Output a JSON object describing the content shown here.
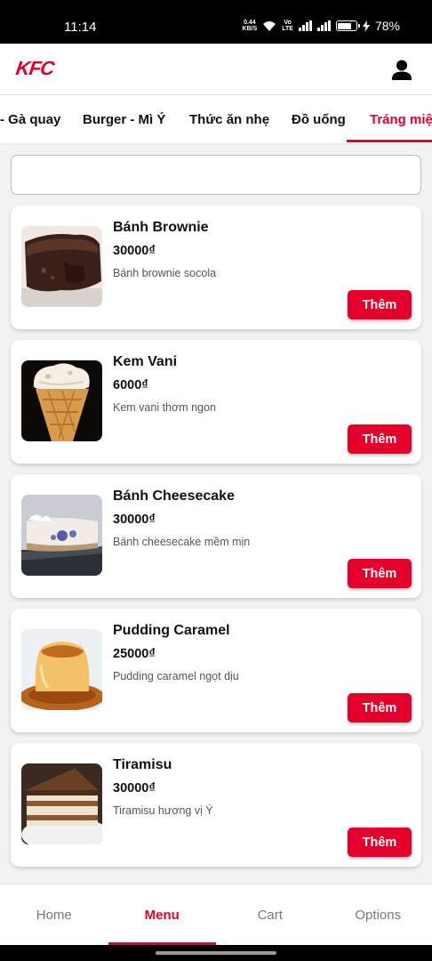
{
  "status_bar": {
    "time": "11:14",
    "net_speed_value": "0.44",
    "net_speed_unit": "KB/S",
    "volte_top": "Vo",
    "volte_bottom": "LTE",
    "battery": "78%"
  },
  "header": {
    "logo": "KFC",
    "brand_color": "#e4002b"
  },
  "tabs": [
    {
      "label": "- Gà quay",
      "active": false
    },
    {
      "label": "Burger - Mì Ý",
      "active": false
    },
    {
      "label": "Thức ăn nhẹ",
      "active": false
    },
    {
      "label": "Đồ uống",
      "active": false
    },
    {
      "label": "Tráng miệng",
      "active": true
    }
  ],
  "search": {
    "value": "",
    "placeholder": ""
  },
  "products": [
    {
      "name": "Bánh Brownie",
      "price": "30000₫",
      "description": "Bánh brownie socola",
      "button": "Thêm",
      "image": "brownie-image"
    },
    {
      "name": "Kem Vani",
      "price": "6000₫",
      "description": "Kem vani thơm ngon",
      "button": "Thêm",
      "image": "ice-cream-image"
    },
    {
      "name": "Bánh Cheesecake",
      "price": "30000₫",
      "description": "Bánh cheesecake mềm mịn",
      "button": "Thêm",
      "image": "cheesecake-image"
    },
    {
      "name": "Pudding Caramel",
      "price": "25000₫",
      "description": "Pudding caramel ngọt dịu",
      "button": "Thêm",
      "image": "pudding-image"
    },
    {
      "name": "Tiramisu",
      "price": "30000₫",
      "description": "Tiramisu hương vị Ý",
      "button": "Thêm",
      "image": "tiramisu-image"
    }
  ],
  "bottom_nav": [
    {
      "label": "Home",
      "active": false
    },
    {
      "label": "Menu",
      "active": true
    },
    {
      "label": "Cart",
      "active": false
    },
    {
      "label": "Options",
      "active": false
    }
  ]
}
